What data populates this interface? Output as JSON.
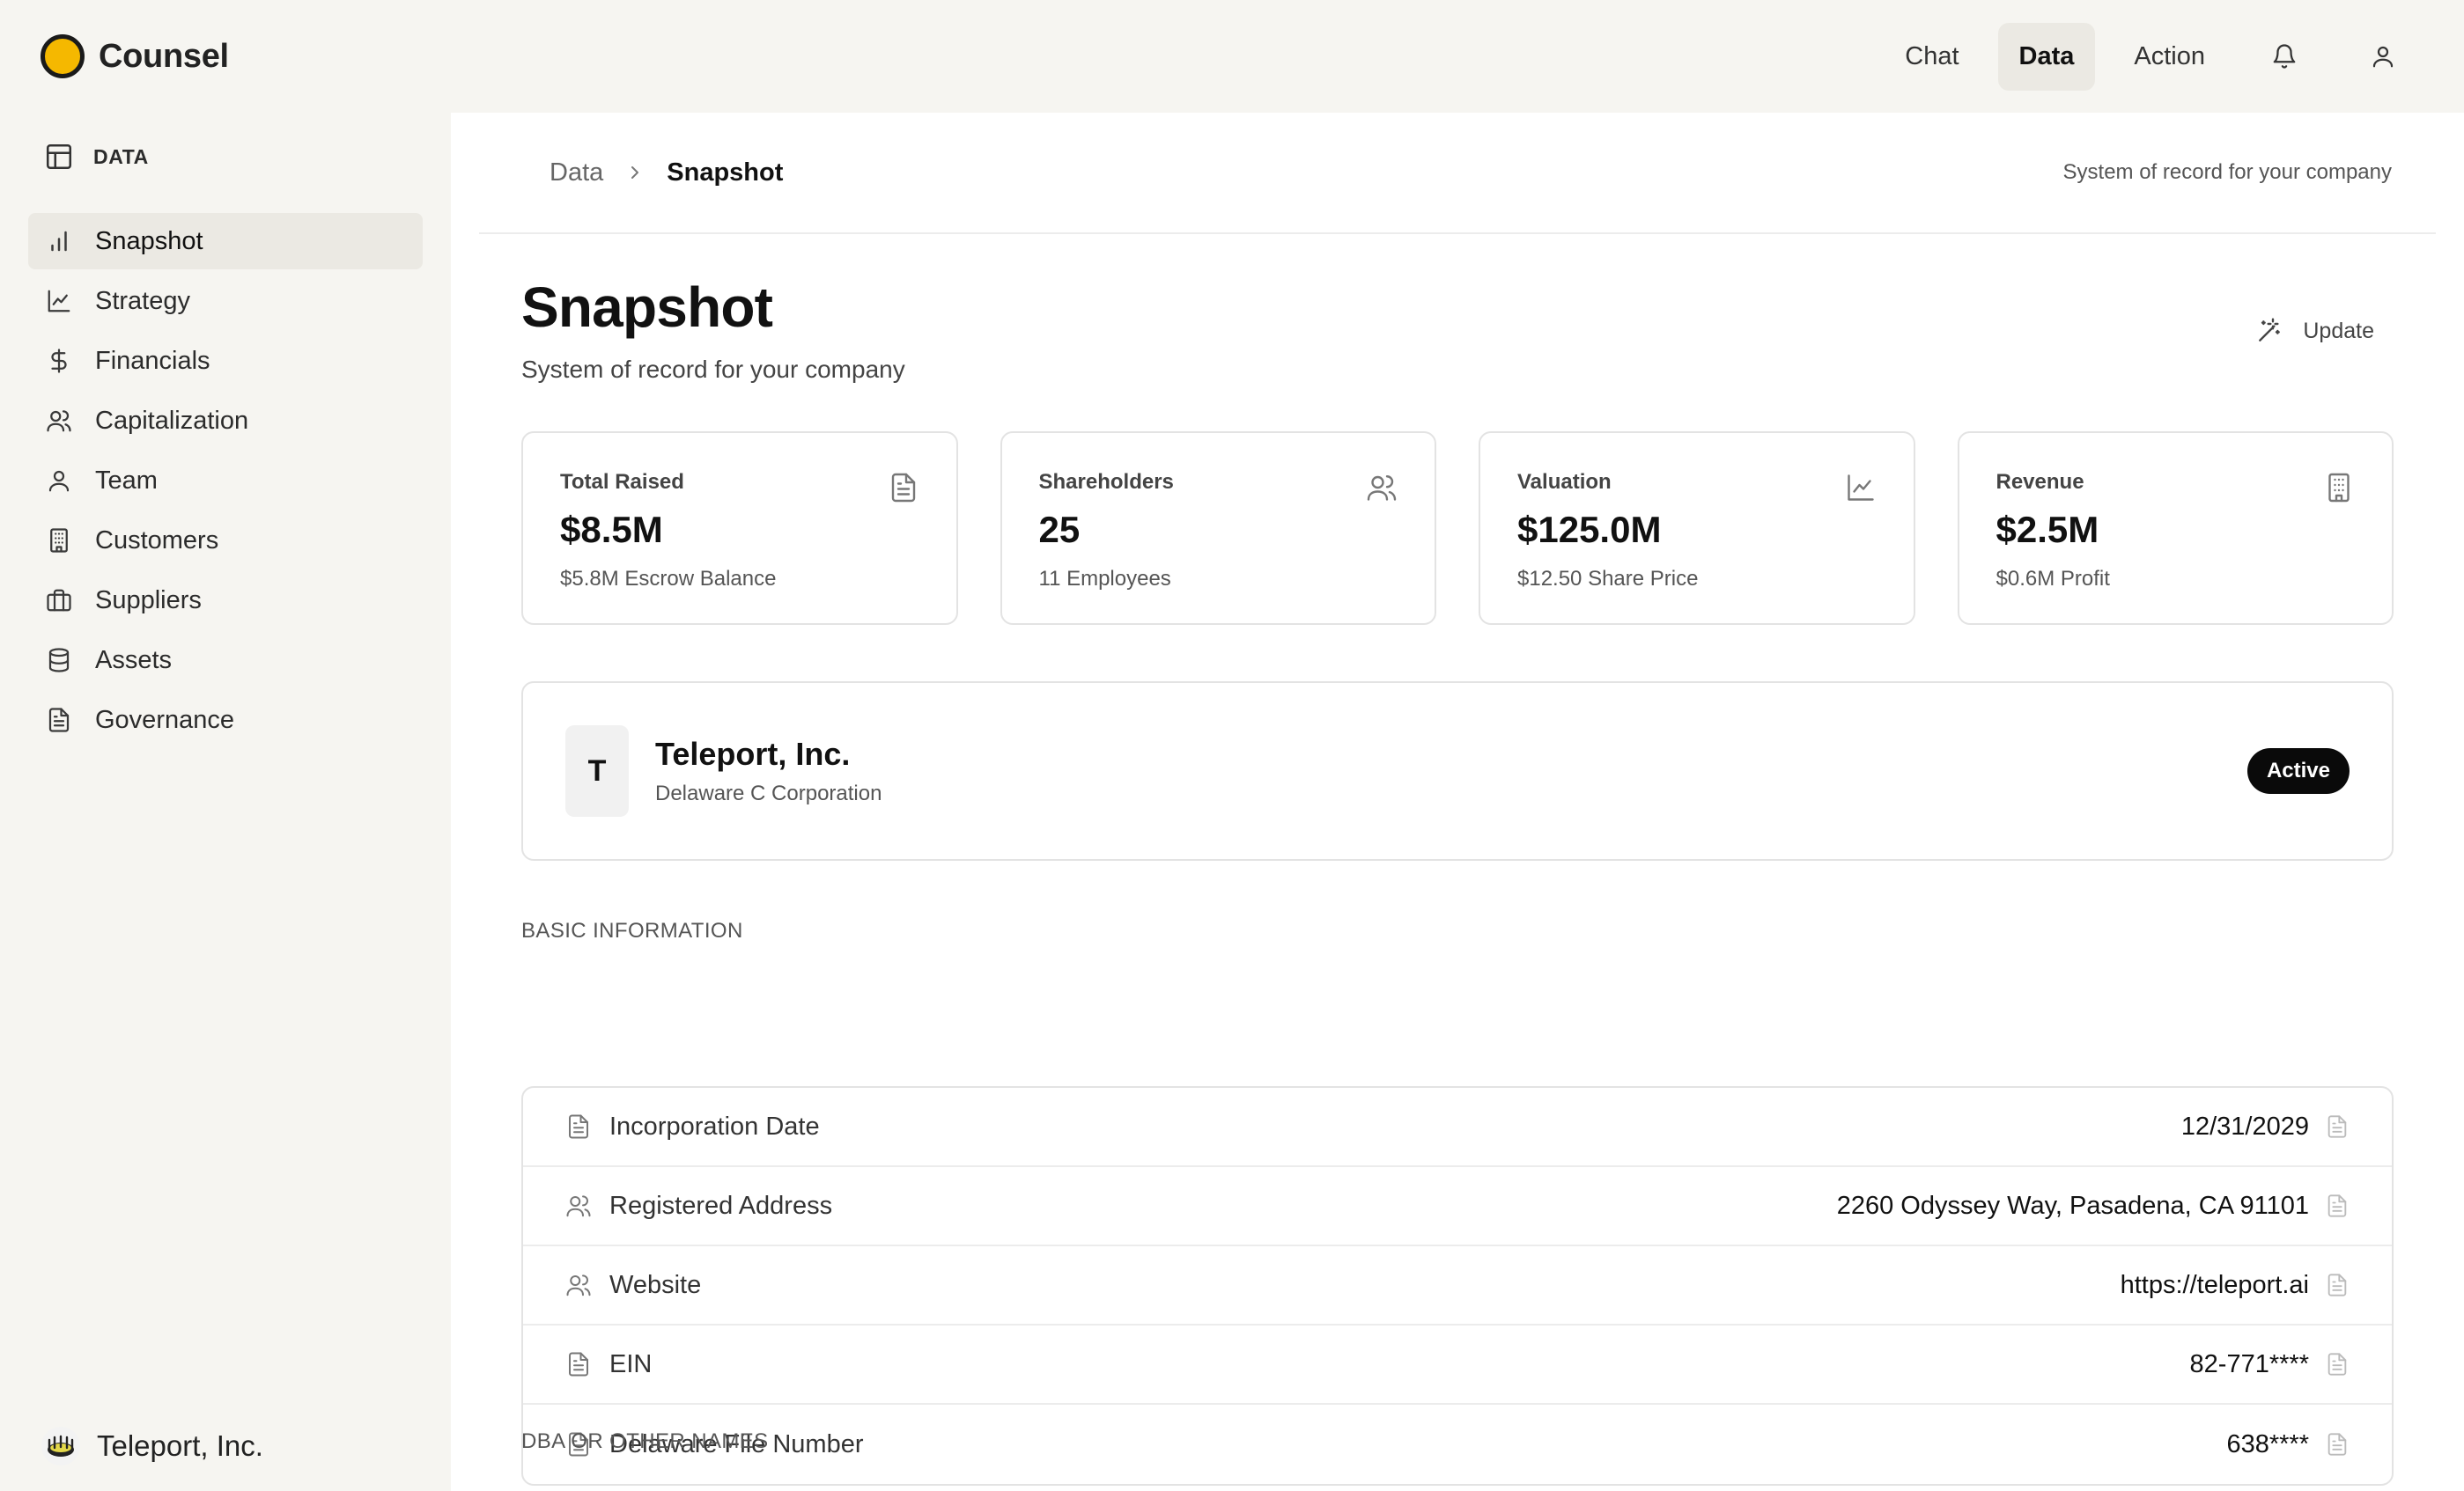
{
  "app": {
    "name": "Counsel"
  },
  "topnav": {
    "tabs": [
      {
        "label": "Chat",
        "active": false
      },
      {
        "label": "Data",
        "active": true
      },
      {
        "label": "Action",
        "active": false
      }
    ],
    "icons": [
      "bell-icon",
      "user-icon"
    ]
  },
  "sidebar": {
    "section_label": "DATA",
    "items": [
      {
        "label": "Snapshot",
        "icon": "bar-chart-icon",
        "active": true
      },
      {
        "label": "Strategy",
        "icon": "line-chart-icon"
      },
      {
        "label": "Financials",
        "icon": "dollar-icon"
      },
      {
        "label": "Capitalization",
        "icon": "users-icon"
      },
      {
        "label": "Team",
        "icon": "user-icon"
      },
      {
        "label": "Customers",
        "icon": "building-icon"
      },
      {
        "label": "Suppliers",
        "icon": "briefcase-icon"
      },
      {
        "label": "Assets",
        "icon": "database-icon"
      },
      {
        "label": "Governance",
        "icon": "document-icon"
      }
    ],
    "org_name": "Teleport, Inc."
  },
  "breadcrumb": {
    "parent": "Data",
    "current": "Snapshot",
    "tagline": "System of record for your company"
  },
  "page": {
    "title": "Snapshot",
    "subtitle": "System of record for your company",
    "update_label": "Update"
  },
  "stats": [
    {
      "label": "Total Raised",
      "value": "$8.5M",
      "sub": "$5.8M Escrow Balance",
      "icon": "document-icon"
    },
    {
      "label": "Shareholders",
      "value": "25",
      "sub": "11 Employees",
      "icon": "users-icon"
    },
    {
      "label": "Valuation",
      "value": "$125.0M",
      "sub": "$12.50 Share Price",
      "icon": "line-chart-icon"
    },
    {
      "label": "Revenue",
      "value": "$2.5M",
      "sub": "$0.6M Profit",
      "icon": "building-icon"
    }
  ],
  "company": {
    "initial": "T",
    "name": "Teleport, Inc.",
    "type": "Delaware C Corporation",
    "status": "Active"
  },
  "basic_info": {
    "title": "BASIC INFORMATION",
    "rows": [
      {
        "label": "Incorporation Date",
        "value": "12/31/2029",
        "icon": "document-icon"
      },
      {
        "label": "Registered Address",
        "value": "2260 Odyssey Way, Pasadena, CA 91101",
        "icon": "users-icon"
      },
      {
        "label": "Website",
        "value": "https://teleport.ai",
        "icon": "users-icon"
      },
      {
        "label": "EIN",
        "value": "82-771****",
        "icon": "document-icon"
      },
      {
        "label": "Delaware File Number",
        "value": "638****",
        "icon": "document-icon"
      }
    ]
  },
  "dba": {
    "title": "DBA OR OTHER NAMES"
  },
  "colors": {
    "background": "#f6f5f1",
    "surface": "#ffffff",
    "accent": "#f5b800",
    "active_tab": "#ebe9e3",
    "badge": "#0a0a0a"
  }
}
